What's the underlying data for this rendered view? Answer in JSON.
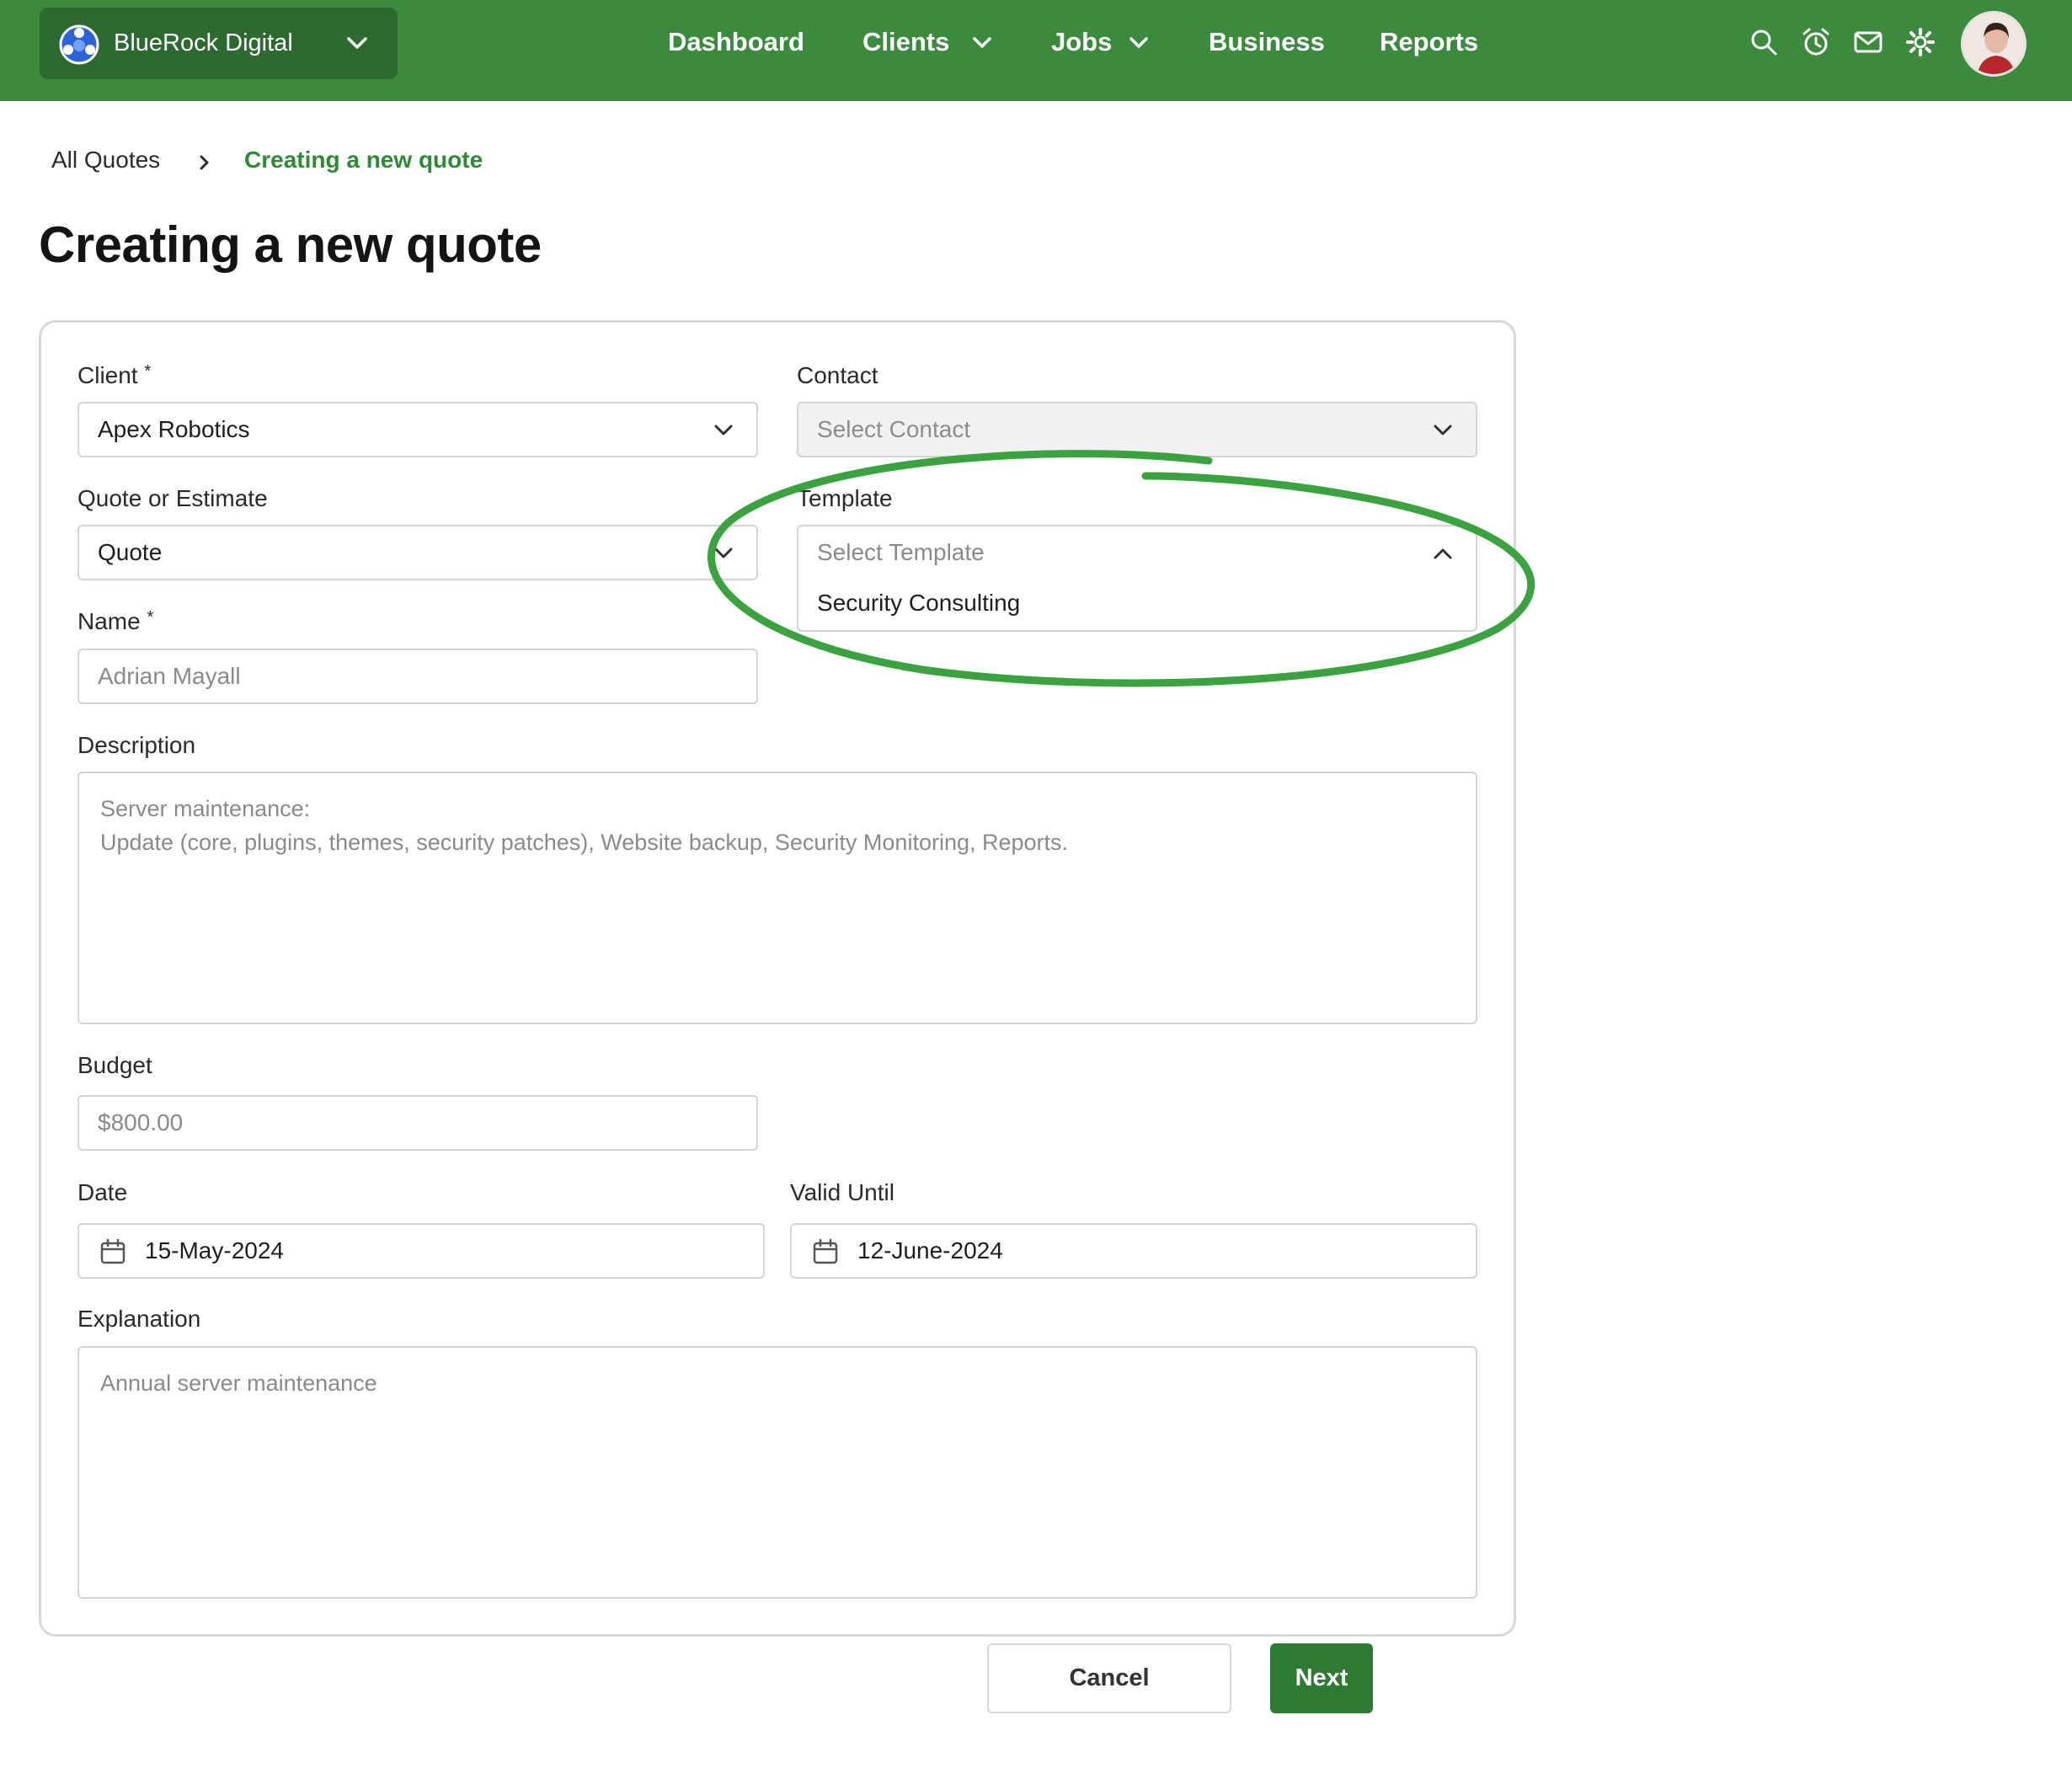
{
  "org": {
    "name": "BlueRock Digital",
    "logo_icon": "globe-logo-icon"
  },
  "nav": {
    "dashboard": "Dashboard",
    "clients": "Clients",
    "jobs": "Jobs",
    "business": "Business",
    "reports": "Reports"
  },
  "toolbar_icons": [
    "search-icon",
    "alarm-clock-icon",
    "mail-icon",
    "gear-icon"
  ],
  "breadcrumb": {
    "parent": "All Quotes",
    "current": "Creating a new quote"
  },
  "page_title": "Creating a new quote",
  "form": {
    "client": {
      "label": "Client",
      "required_mark": "*",
      "value": "Apex Robotics"
    },
    "contact": {
      "label": "Contact",
      "placeholder": "Select Contact"
    },
    "quote_type": {
      "label": "Quote or Estimate",
      "value": "Quote"
    },
    "template": {
      "label": "Template",
      "placeholder": "Select Template",
      "options": [
        "Security Consulting"
      ]
    },
    "name": {
      "label": "Name",
      "required_mark": "*",
      "value": "Adrian Mayall"
    },
    "description": {
      "label": "Description",
      "lines": [
        "Server maintenance:",
        "Update (core, plugins, themes, security patches), Website backup, Security Monitoring, Reports."
      ]
    },
    "budget": {
      "label": "Budget",
      "value": "$800.00"
    },
    "date": {
      "label": "Date",
      "value": "15-May-2024"
    },
    "valid_until": {
      "label": "Valid Until",
      "value": "12-June-2024"
    },
    "explanation": {
      "label": "Explanation",
      "value": "Annual server maintenance"
    }
  },
  "actions": {
    "cancel": "Cancel",
    "next": "Next"
  },
  "colors": {
    "nav_bg": "#3b8a3e",
    "org_bg": "#2c6a2f",
    "accent": "#2f8a35",
    "primary_button": "#2f7a33",
    "highlight_ring": "#3aa23f"
  }
}
